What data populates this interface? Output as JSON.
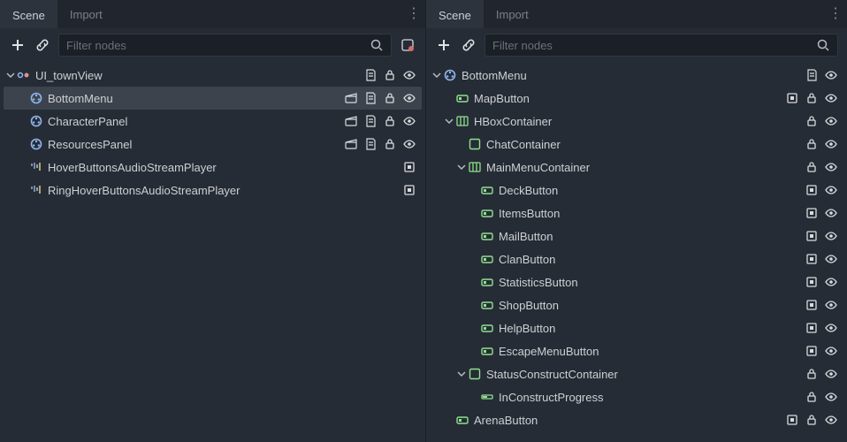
{
  "tabs": {
    "scene": "Scene",
    "import": "Import"
  },
  "search": {
    "placeholder": "Filter nodes"
  },
  "left": {
    "root": {
      "label": "UI_townView",
      "icon": "canvaslayer",
      "chev": "down",
      "trail": [
        "script",
        "lock",
        "eye"
      ]
    },
    "items": [
      {
        "label": "BottomMenu",
        "icon": "control-blue",
        "trail": [
          "clapper",
          "script",
          "lock",
          "eye"
        ],
        "selected": true
      },
      {
        "label": "CharacterPanel",
        "icon": "control-blue",
        "trail": [
          "clapper",
          "script",
          "lock",
          "eye"
        ]
      },
      {
        "label": "ResourcesPanel",
        "icon": "control-blue",
        "trail": [
          "clapper",
          "script",
          "lock",
          "eye"
        ]
      },
      {
        "label": "HoverButtonsAudioStreamPlayer",
        "icon": "audio",
        "trail": [
          "mono"
        ]
      },
      {
        "label": "RingHoverButtonsAudioStreamPlayer",
        "icon": "audio",
        "trail": [
          "mono"
        ]
      }
    ]
  },
  "right": {
    "rows": [
      {
        "depth": 0,
        "chev": "down",
        "label": "BottomMenu",
        "icon": "control-blue",
        "trail": [
          "script",
          "eye"
        ]
      },
      {
        "depth": 1,
        "chev": "",
        "label": "MapButton",
        "icon": "button",
        "trail": [
          "mono",
          "lock",
          "eye"
        ]
      },
      {
        "depth": 1,
        "chev": "down",
        "label": "HBoxContainer",
        "icon": "hbox",
        "trail": [
          "lock",
          "eye"
        ]
      },
      {
        "depth": 2,
        "chev": "",
        "label": "ChatContainer",
        "icon": "panel",
        "trail": [
          "lock",
          "eye"
        ]
      },
      {
        "depth": 2,
        "chev": "down",
        "label": "MainMenuContainer",
        "icon": "hbox",
        "trail": [
          "lock",
          "eye"
        ]
      },
      {
        "depth": 3,
        "chev": "",
        "label": "DeckButton",
        "icon": "button",
        "trail": [
          "mono",
          "eye"
        ]
      },
      {
        "depth": 3,
        "chev": "",
        "label": "ItemsButton",
        "icon": "button",
        "trail": [
          "mono",
          "eye"
        ]
      },
      {
        "depth": 3,
        "chev": "",
        "label": "MailButton",
        "icon": "button",
        "trail": [
          "mono",
          "eye"
        ]
      },
      {
        "depth": 3,
        "chev": "",
        "label": "ClanButton",
        "icon": "button",
        "trail": [
          "mono",
          "eye"
        ]
      },
      {
        "depth": 3,
        "chev": "",
        "label": "StatisticsButton",
        "icon": "button",
        "trail": [
          "mono",
          "eye"
        ]
      },
      {
        "depth": 3,
        "chev": "",
        "label": "ShopButton",
        "icon": "button",
        "trail": [
          "mono",
          "eye"
        ]
      },
      {
        "depth": 3,
        "chev": "",
        "label": "HelpButton",
        "icon": "button",
        "trail": [
          "mono",
          "eye"
        ]
      },
      {
        "depth": 3,
        "chev": "",
        "label": "EscapeMenuButton",
        "icon": "button",
        "trail": [
          "mono",
          "eye"
        ]
      },
      {
        "depth": 2,
        "chev": "down",
        "label": "StatusConstructContainer",
        "icon": "panel",
        "trail": [
          "lock",
          "eye"
        ]
      },
      {
        "depth": 3,
        "chev": "",
        "label": "InConstructProgress",
        "icon": "progress",
        "trail": [
          "lock",
          "eye"
        ]
      },
      {
        "depth": 1,
        "chev": "",
        "label": "ArenaButton",
        "icon": "button",
        "trail": [
          "mono",
          "lock",
          "eye"
        ]
      }
    ]
  }
}
